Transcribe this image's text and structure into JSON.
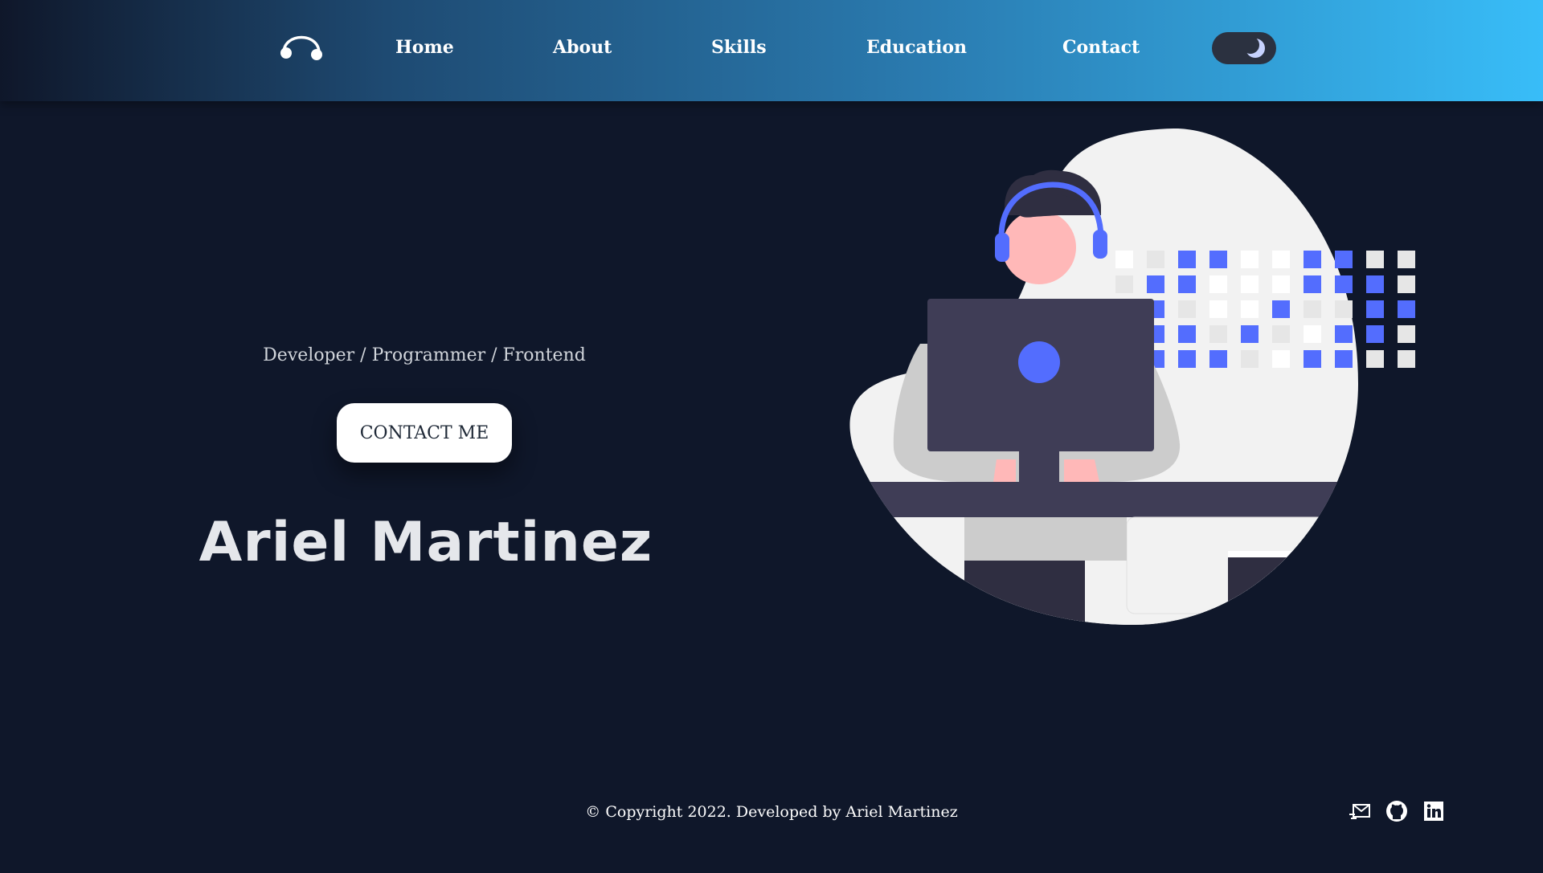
{
  "nav": {
    "logo_icon": "headphones-icon",
    "links": [
      "Home",
      "About",
      "Skills",
      "Education",
      "Contact"
    ],
    "theme_toggle_icon": "moon-icon"
  },
  "hero": {
    "name": "Ariel Martinez",
    "subtitle": "Developer / Programmer / Frontend",
    "cta": "CONTACT ME",
    "illustration": "developer-with-headset-at-computer"
  },
  "footer": {
    "copyright": "© Copyright 2022. Developed by Ariel Martinez",
    "social_icons": [
      "mail-icon",
      "github-icon",
      "linkedin-icon"
    ]
  },
  "colors": {
    "background": "#0f172a",
    "accent": "#536dfe",
    "nav_gradient_end": "#38bdf8"
  }
}
